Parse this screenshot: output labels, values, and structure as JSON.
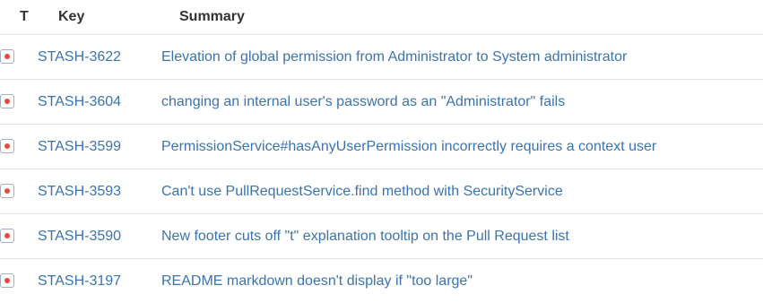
{
  "headers": {
    "type": "T",
    "key": "Key",
    "summary": "Summary"
  },
  "colors": {
    "link": "#3b73af",
    "bug_icon_dot": "#e5493a"
  },
  "rows": [
    {
      "type_icon": "bug-icon",
      "key": "STASH-3622",
      "summary": "Elevation of global permission from Administrator to System administrator"
    },
    {
      "type_icon": "bug-icon",
      "key": "STASH-3604",
      "summary": "changing an internal user's password as an \"Administrator\" fails"
    },
    {
      "type_icon": "bug-icon",
      "key": "STASH-3599",
      "summary": "PermissionService#hasAnyUserPermission incorrectly requires a context user"
    },
    {
      "type_icon": "bug-icon",
      "key": "STASH-3593",
      "summary": "Can't use PullRequestService.find method with SecurityService"
    },
    {
      "type_icon": "bug-icon",
      "key": "STASH-3590",
      "summary": "New footer cuts off \"t\" explanation tooltip on the Pull Request list"
    },
    {
      "type_icon": "bug-icon",
      "key": "STASH-3197",
      "summary": "README markdown doesn't display if \"too large\""
    }
  ]
}
